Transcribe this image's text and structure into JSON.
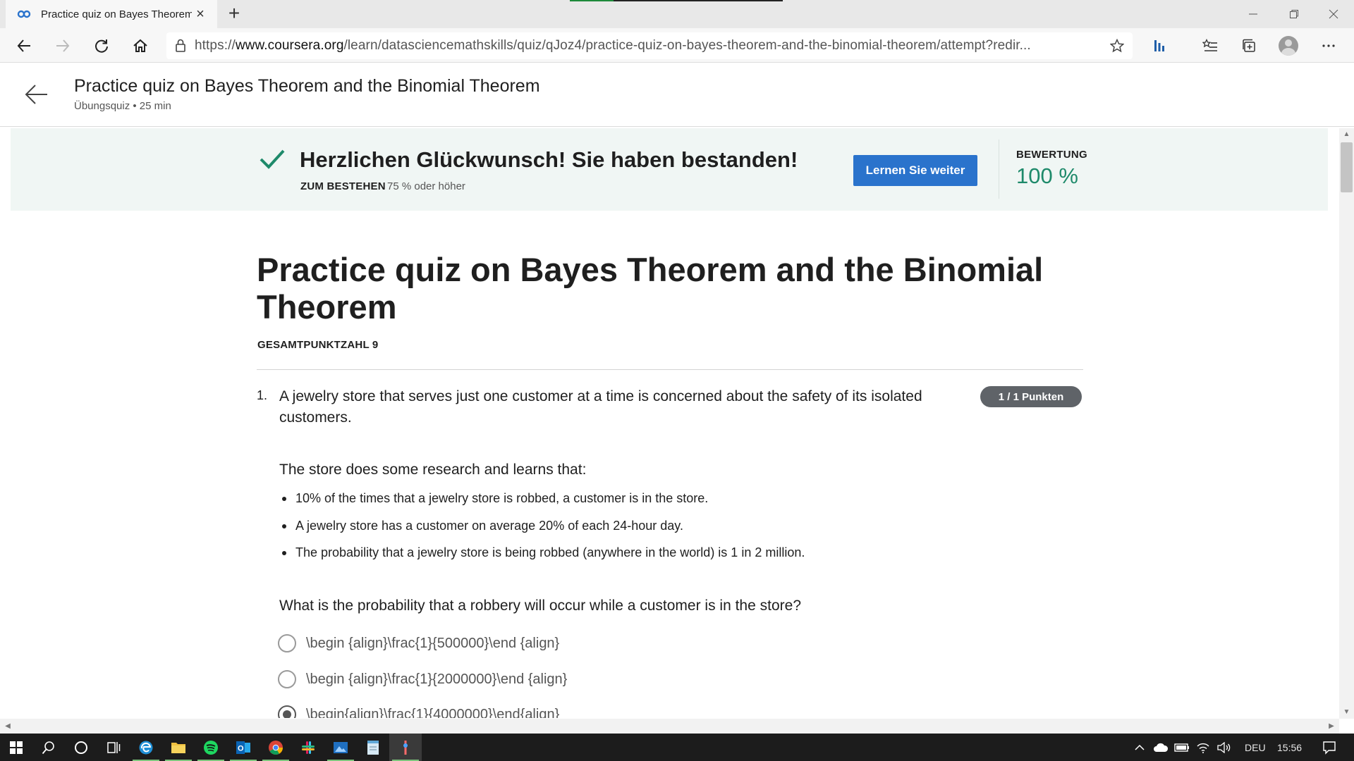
{
  "browser": {
    "tab_title": "Practice quiz on Bayes Theorem",
    "url_prefix": "https://",
    "url_host": "www.coursera.org",
    "url_path": "/learn/datasciencemathskills/quiz/qJoz4/practice-quiz-on-bayes-theorem-and-the-binomial-theorem/attempt?redir..."
  },
  "header": {
    "title": "Practice quiz on Bayes Theorem and the Binomial Theorem",
    "subtitle": "Übungsquiz • 25 min"
  },
  "banner": {
    "congrats": "Herzlichen Glückwunsch! Sie haben bestanden!",
    "pass_label": "ZUM BESTEHEN",
    "pass_value": "75 % oder höher",
    "continue_label": "Lernen Sie weiter",
    "grade_label": "BEWERTUNG",
    "grade_value": "100 %",
    "accent_color": "#1e8a6a",
    "button_color": "#2a73cc"
  },
  "quiz": {
    "title": "Practice quiz on Bayes Theorem and the Binomial Theorem",
    "total_points": "GESAMTPUNKTZAHL 9",
    "question": {
      "number": "1.",
      "text": "A jewelry store that serves just one customer at a time is concerned about the safety of its isolated customers.",
      "points": "1 / 1 Punkten",
      "intro": "The store does some research and learns that:",
      "bullets": [
        "10% of the times that a jewelry store is robbed, a customer is in the store.",
        "A jewelry store has a customer on average 20% of each 24-hour day.",
        "The probability that a jewelry store is being robbed (anywhere in the world) is 1 in 2 million."
      ],
      "ask": "What is the probability that a robbery will occur while a customer is in the store?",
      "options": [
        {
          "text": "\\begin {align}\\frac{1}{500000}\\end {align}",
          "selected": false
        },
        {
          "text": "\\begin {align}\\frac{1}{2000000}\\end {align}",
          "selected": false
        },
        {
          "text": "\\begin{align}\\frac{1}{4000000}\\end{align}",
          "selected": true
        }
      ]
    }
  },
  "taskbar": {
    "language": "DEU",
    "time": "15:56"
  }
}
